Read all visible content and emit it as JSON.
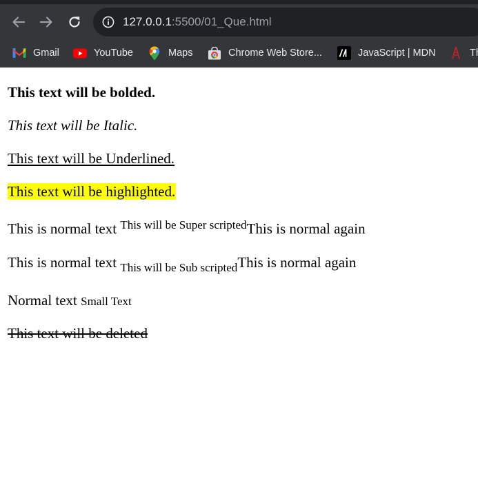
{
  "browser": {
    "url_host": "127.0.0.1",
    "url_path": ":5500/01_Que.html",
    "bookmarks": [
      {
        "label": "Gmail",
        "icon": "gmail-icon"
      },
      {
        "label": "YouTube",
        "icon": "youtube-icon"
      },
      {
        "label": "Maps",
        "icon": "maps-icon"
      },
      {
        "label": "Chrome Web Store...",
        "icon": "chrome-web-store-icon"
      },
      {
        "label": "JavaScript | MDN",
        "icon": "mdn-icon"
      },
      {
        "label": "Th",
        "icon": "bookmark-icon"
      }
    ],
    "colors": {
      "frame": "#35363a",
      "omnibox": "#202124",
      "text": "#e8eaed",
      "muted": "#9aa0a6"
    }
  },
  "page": {
    "bold_text": "This text will be bolded.",
    "italic_text": "This text will be Italic.",
    "underlined_text": "This text will be Underlined.",
    "highlighted_text": "This text will be highlighted.",
    "superscript_line": {
      "normal": "This is normal text ",
      "sup": "This will be Super scripted",
      "after": "This is normal again"
    },
    "subscript_line": {
      "normal": "This is normal text ",
      "sub": "This will be Sub scripted",
      "after": "This is normal again"
    },
    "small_line": {
      "normal": "Normal text ",
      "small": "Small Text"
    },
    "deleted_text": "This text will be deleted",
    "highlight_color": "#ffff00"
  }
}
